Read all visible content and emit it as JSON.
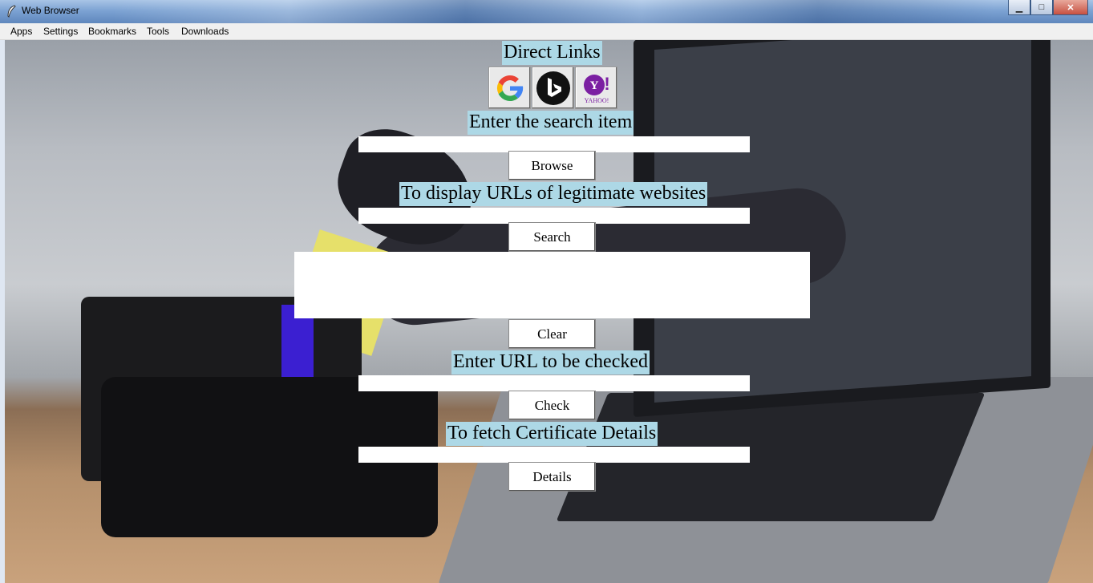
{
  "window": {
    "title": "Web Browser"
  },
  "menubar": {
    "items": [
      "Apps",
      "Settings",
      "Bookmarks",
      "Tools",
      "Downloads"
    ]
  },
  "labels": {
    "direct_links": "Direct Links",
    "search_item": "Enter the search item",
    "display_urls": "To display URLs of legitimate websites",
    "url_check": "Enter URL to be checked",
    "certificate": "To fetch Certificate Details"
  },
  "buttons": {
    "browse": "Browse",
    "search": "Search",
    "clear": "Clear",
    "check": "Check",
    "details": "Details"
  },
  "direct_links": [
    {
      "name": "Google",
      "icon": "google-icon"
    },
    {
      "name": "Bing",
      "icon": "bing-icon"
    },
    {
      "name": "Yahoo",
      "icon": "yahoo-icon",
      "text": "YAHOO!"
    }
  ],
  "inputs": {
    "search_item": "",
    "display_urls": "",
    "url_check": "",
    "certificate": ""
  },
  "results_text": "",
  "colors": {
    "label_bg": "#add8e6"
  }
}
